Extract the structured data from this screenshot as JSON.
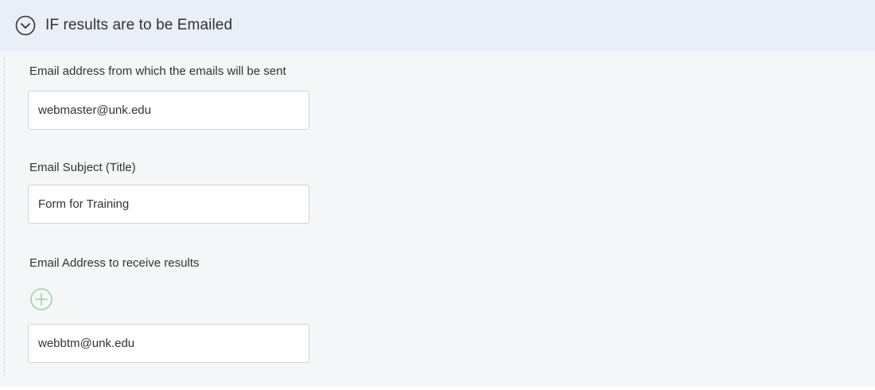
{
  "section": {
    "title": "IF results are to be Emailed",
    "toggle_icon": "chevron-down-circle-icon"
  },
  "fields": {
    "from_email": {
      "label": "Email address from which the emails will be sent",
      "value": "webmaster@unk.edu"
    },
    "subject": {
      "label": "Email Subject (Title)",
      "value": "Form for Training"
    },
    "recipients": {
      "label": "Email Address to receive results",
      "add_icon": "plus-circle-icon",
      "values": [
        "webbtm@unk.edu"
      ]
    }
  },
  "colors": {
    "header_bg": "#e9eff6",
    "body_bg": "#f5f6f8",
    "add_green": "#9ad5a0"
  }
}
